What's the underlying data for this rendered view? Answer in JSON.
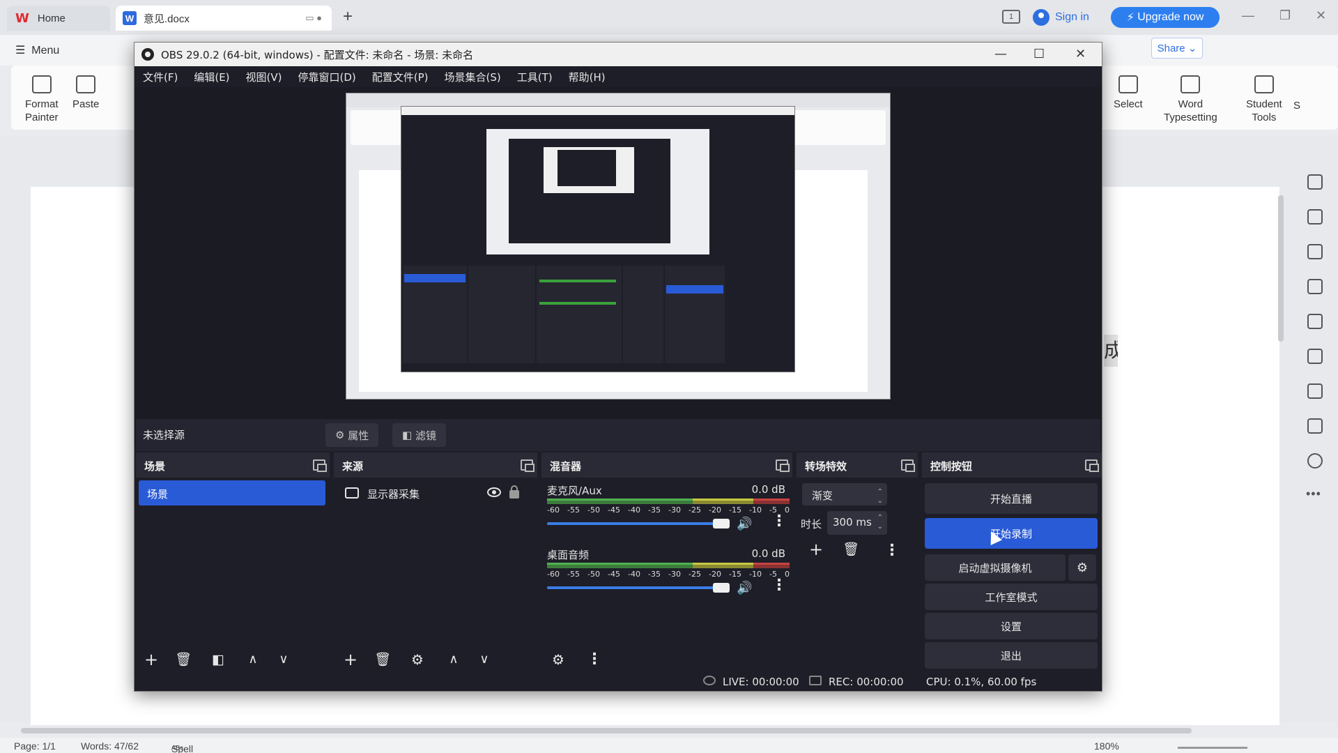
{
  "wps": {
    "tabs": [
      {
        "label": "Home"
      },
      {
        "label": "意见.docx"
      }
    ],
    "sign_in": "Sign in",
    "upgrade": "Upgrade now",
    "menu": "Menu",
    "share": "Share",
    "ribbon": {
      "format_painter_1": "Format",
      "format_painter_2": "Painter",
      "paste": "Paste",
      "select": "Select",
      "word_typesetting_1": "Word",
      "word_typesetting_2": "Typesetting",
      "student_tools_1": "Student",
      "student_tools_2": "Tools",
      "more": "S"
    },
    "doc_fragment": "成",
    "status": {
      "page": "Page: 1/1",
      "words": "Words: 47/62",
      "spell": "Spell Check",
      "zoom": "180%"
    }
  },
  "obs": {
    "title": "OBS 29.0.2 (64-bit, windows) - 配置文件: 未命名 - 场景: 未命名",
    "menu": [
      "文件(F)",
      "编辑(E)",
      "视图(V)",
      "停靠窗口(D)",
      "配置文件(P)",
      "场景集合(S)",
      "工具(T)",
      "帮助(H)"
    ],
    "source_bar": {
      "label": "未选择源",
      "properties": "属性",
      "filters": "滤镜"
    },
    "docks": {
      "scenes": {
        "title": "场景",
        "items": [
          "场景"
        ]
      },
      "sources": {
        "title": "来源",
        "items": [
          "显示器采集"
        ]
      },
      "mixer": {
        "title": "混音器",
        "tracks": [
          {
            "name": "麦克风/Aux",
            "db": "0.0 dB"
          },
          {
            "name": "桌面音频",
            "db": "0.0 dB"
          }
        ],
        "ticks": [
          "-60",
          "-55",
          "-50",
          "-45",
          "-40",
          "-35",
          "-30",
          "-25",
          "-20",
          "-15",
          "-10",
          "-5",
          "0"
        ]
      },
      "transitions": {
        "title": "转场特效",
        "selected": "渐变",
        "duration_label": "时长",
        "duration": "300 ms"
      },
      "controls": {
        "title": "控制按钮",
        "start_stream": "开始直播",
        "start_record": "开始录制",
        "virtual_cam": "启动虚拟摄像机",
        "studio_mode": "工作室模式",
        "settings": "设置",
        "exit": "退出"
      }
    },
    "status": {
      "live": "LIVE: 00:00:00",
      "rec": "REC: 00:00:00",
      "cpu": "CPU: 0.1%, 60.00 fps"
    }
  }
}
